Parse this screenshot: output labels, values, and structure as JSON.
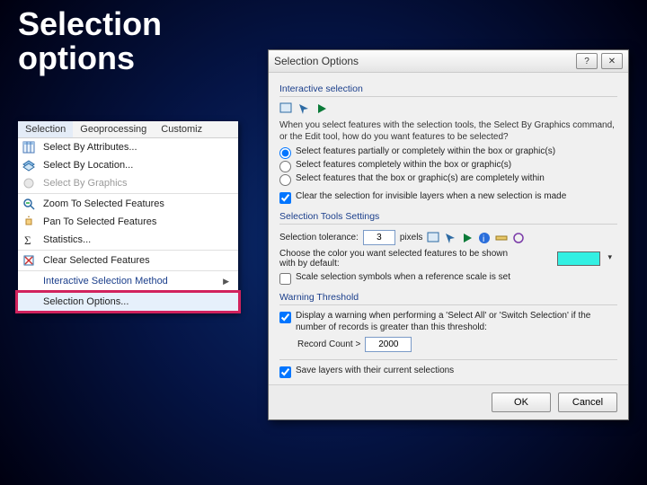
{
  "title_line1": "Selection",
  "title_line2": "options",
  "menubar": {
    "selection": "Selection",
    "geoprocessing": "Geoprocessing",
    "customize": "Customiz"
  },
  "menu": {
    "by_attr": "Select By Attributes...",
    "by_loc": "Select By Location...",
    "by_gfx": "Select By Graphics",
    "zoom": "Zoom To Selected Features",
    "pan": "Pan To Selected Features",
    "stats": "Statistics...",
    "clear": "Clear Selected Features",
    "interactive": "Interactive Selection Method",
    "options": "Selection Options..."
  },
  "dialog": {
    "title": "Selection Options",
    "groups": {
      "interactive": "Interactive selection",
      "tools": "Selection Tools Settings",
      "warning": "Warning Threshold"
    },
    "help1": "When you select features with the selection tools, the Select By Graphics command, or the Edit tool, how do you want features to be selected?",
    "radio1": "Select features partially or completely within the box or graphic(s)",
    "radio2": "Select features completely within the box or graphic(s)",
    "radio3": "Select features that the box or graphic(s) are completely within",
    "clear_invisible": "Clear the selection for invisible layers when a new selection is made",
    "tol_label": "Selection tolerance:",
    "tol_value": "3",
    "tol_unit": "pixels",
    "color_help": "Choose the color you want selected features to be shown with by default:",
    "scale_sym": "Scale selection symbols when a reference scale is set",
    "warn_check": "Display a warning when performing a 'Select All' or 'Switch Selection' if the number of records is greater than this threshold:",
    "record_label": "Record Count >",
    "record_value": "2000",
    "save_layers": "Save layers with their current selections",
    "ok": "OK",
    "cancel": "Cancel"
  }
}
